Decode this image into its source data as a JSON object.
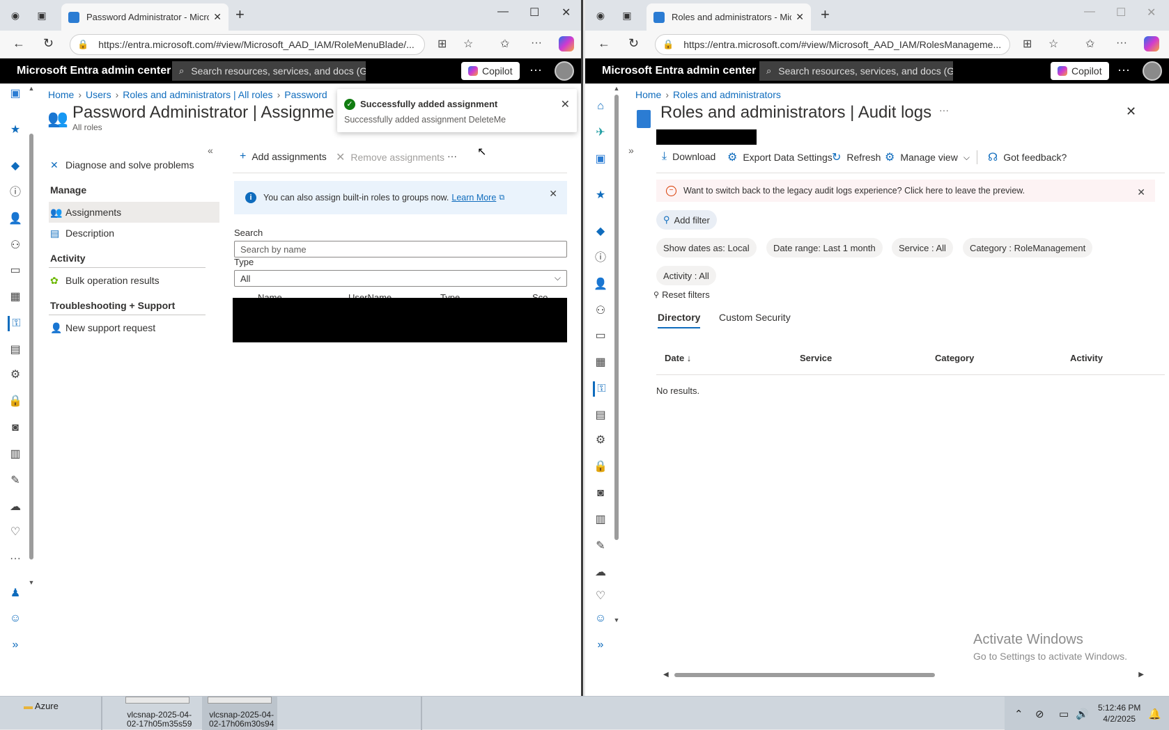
{
  "left": {
    "tab_title": "Password Administrator - Microsoft",
    "url": "https://entra.microsoft.com/#view/Microsoft_AAD_IAM/RoleMenuBlade/...",
    "header": {
      "brand": "Microsoft Entra admin center",
      "search_placeholder": "Search resources, services, and docs (G+/)",
      "copilot": "Copilot"
    },
    "breadcrumb": [
      "Home",
      "Users",
      "Roles and administrators | All roles",
      "Password"
    ],
    "title": "Password Administrator | Assignme",
    "subtitle": "All roles",
    "nav": {
      "diagnose": "Diagnose and solve problems",
      "manage_header": "Manage",
      "assignments": "Assignments",
      "description": "Description",
      "activity_header": "Activity",
      "bulk": "Bulk operation results",
      "ts_header": "Troubleshooting + Support",
      "support": "New support request"
    },
    "commands": {
      "add": "Add assignments",
      "remove": "Remove assignments",
      "more": "···"
    },
    "info": {
      "text": "You can also assign built-in roles to groups now.",
      "link": "Learn More"
    },
    "search_label": "Search",
    "search_placeholder": "Search by name",
    "type_label": "Type",
    "type_value": "All",
    "columns": [
      "Name",
      "UserName",
      "Type",
      "Sco"
    ],
    "toast": {
      "title": "Successfully added assignment",
      "body": "Successfully added assignment DeleteMe"
    }
  },
  "right": {
    "tab_title": "Roles and administrators - Micro",
    "url": "https://entra.microsoft.com/#view/Microsoft_AAD_IAM/RolesManageme...",
    "header": {
      "brand": "Microsoft Entra admin center",
      "search_placeholder": "Search resources, services, and docs (G+/)",
      "copilot": "Copilot"
    },
    "breadcrumb": [
      "Home",
      "Roles and administrators"
    ],
    "title": "Roles and administrators | Audit logs",
    "title_more": "···",
    "commands": {
      "download": "Download",
      "export": "Export Data Settings",
      "refresh": "Refresh",
      "manage_view": "Manage view",
      "feedback": "Got feedback?"
    },
    "warning": "Want to switch back to the legacy audit logs experience? Click here to leave the preview.",
    "add_filter": "Add filter",
    "pills": [
      "Show dates as: Local",
      "Date range: Last 1 month",
      "Service : All",
      "Category : RoleManagement",
      "Activity : All"
    ],
    "reset_filters": "Reset filters",
    "tabs": [
      "Directory",
      "Custom Security"
    ],
    "grid_headers": [
      "Date ↓",
      "Service",
      "Category",
      "Activity"
    ],
    "no_results": "No results."
  },
  "watermark": {
    "line1": "Activate Windows",
    "line2": "Go to Settings to activate Windows."
  },
  "taskbar": {
    "folder": "Azure",
    "file1": [
      "vlcsnap-2025-04-",
      "02-17h05m35s59"
    ],
    "file2": [
      "vlcsnap-2025-04-",
      "02-17h06m30s94"
    ],
    "time": "5:12:46 PM",
    "date": "4/2/2025"
  }
}
